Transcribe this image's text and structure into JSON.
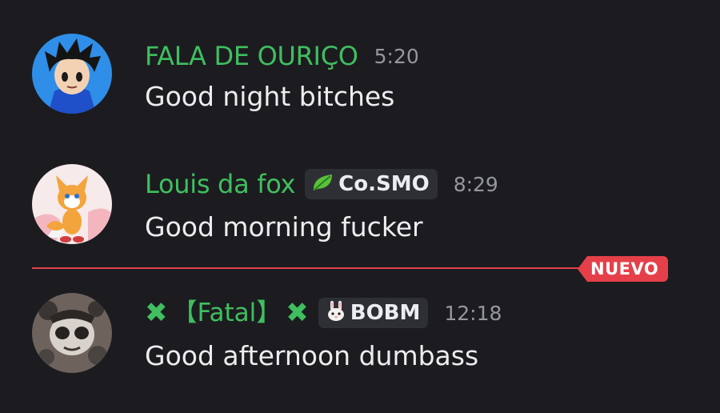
{
  "messages": [
    {
      "username": "FALA DE OURIÇO",
      "timestamp": "5:20",
      "content": "Good night bitches",
      "avatar": "blue-spiky-hair-character-avatar"
    },
    {
      "username": "Louis da fox",
      "tag": {
        "icon": "leaf-icon",
        "label": "Co.SMO"
      },
      "timestamp": "8:29",
      "content": "Good morning fucker",
      "avatar": "orange-fox-character-avatar"
    },
    {
      "prefix_mark": "✖",
      "username": "【Fatal】",
      "suffix_mark": "✖",
      "tag": {
        "icon": "bunny-icon",
        "label": "BOBM"
      },
      "timestamp": "12:18",
      "content": "Good afternoon dumbass",
      "avatar": "dark-masked-character-avatar"
    }
  ],
  "new_divider": {
    "label": "NUEVO",
    "color": "#e5404a"
  },
  "colors": {
    "background": "#1c1c20",
    "username": "#3fbf5f",
    "timestamp": "#95979f",
    "text": "#ecedef",
    "tag_bg": "#2e2f35"
  }
}
